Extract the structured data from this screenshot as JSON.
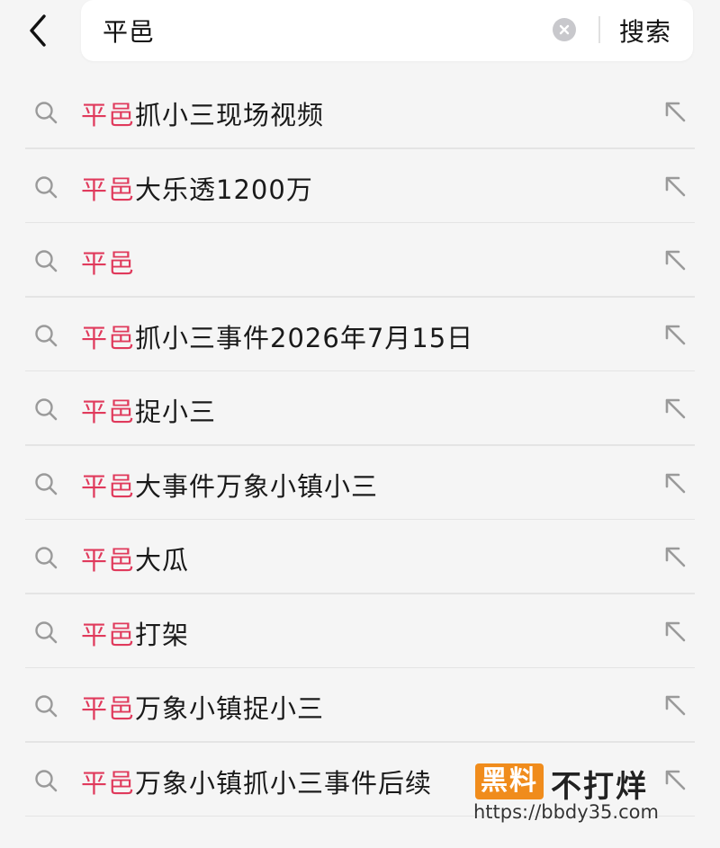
{
  "header": {
    "back_icon": "chevron-left-icon",
    "search_value": "平邑",
    "clear_icon": "clear-circle-icon",
    "search_button_label": "搜索"
  },
  "colors": {
    "highlight": "#e03a5c",
    "background": "#f5f5f5",
    "watermark_badge": "#f08c1c"
  },
  "suggestions": [
    {
      "highlight": "平邑",
      "rest": "抓小三现场视频"
    },
    {
      "highlight": "平邑",
      "rest": "大乐透1200万"
    },
    {
      "highlight": "平邑",
      "rest": ""
    },
    {
      "highlight": "平邑",
      "rest": "抓小三事件2026年7月15日"
    },
    {
      "highlight": "平邑",
      "rest": "捉小三"
    },
    {
      "highlight": "平邑",
      "rest": "大事件万象小镇小三"
    },
    {
      "highlight": "平邑",
      "rest": "大瓜"
    },
    {
      "highlight": "平邑",
      "rest": "打架"
    },
    {
      "highlight": "平邑",
      "rest": "万象小镇捉小三"
    },
    {
      "highlight": "平邑",
      "rest": "万象小镇抓小三事件后续"
    }
  ],
  "watermark": {
    "badge": "黑料",
    "text": "不打烊",
    "url": "https://bbdy35.com"
  }
}
